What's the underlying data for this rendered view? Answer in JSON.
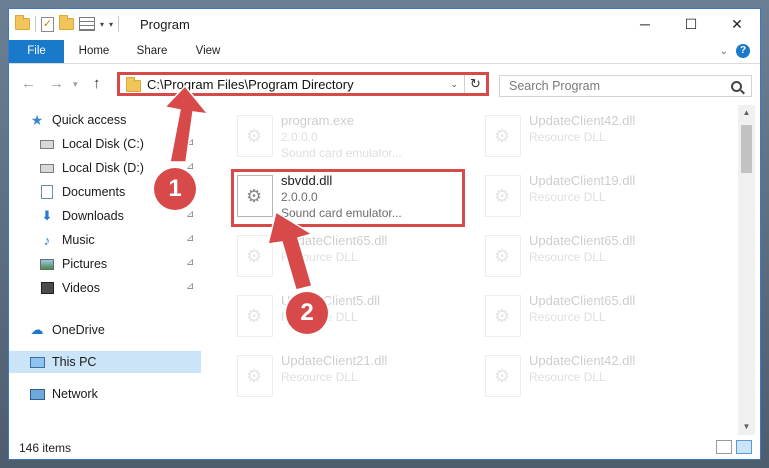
{
  "window": {
    "title": "Program",
    "minimize_glyph": "─",
    "maximize_glyph": "☐",
    "close_glyph": "✕"
  },
  "ribbon": {
    "tabs": [
      "File",
      "Home",
      "Share",
      "View"
    ]
  },
  "address": {
    "path": "C:\\Program Files\\Program Directory",
    "search_placeholder": "Search Program"
  },
  "sidebar": {
    "items": [
      {
        "label": "Quick access",
        "icon": "star-icon",
        "pinned": false
      },
      {
        "label": "Local Disk (C:)",
        "icon": "drive-icon",
        "pinned": true
      },
      {
        "label": "Local Disk (D:)",
        "icon": "drive-icon",
        "pinned": true
      },
      {
        "label": "Documents",
        "icon": "documents-icon",
        "pinned": true
      },
      {
        "label": "Downloads",
        "icon": "downloads-icon",
        "pinned": true
      },
      {
        "label": "Music",
        "icon": "music-icon",
        "pinned": true
      },
      {
        "label": "Pictures",
        "icon": "pictures-icon",
        "pinned": true
      },
      {
        "label": "Videos",
        "icon": "videos-icon",
        "pinned": true
      },
      {
        "label": "OneDrive",
        "icon": "onedrive-icon",
        "pinned": false
      },
      {
        "label": "This PC",
        "icon": "this-pc-icon",
        "pinned": false,
        "selected": true
      },
      {
        "label": "Network",
        "icon": "network-icon",
        "pinned": false
      }
    ]
  },
  "files": [
    {
      "name": "program.exe",
      "line1": "2.0.0.0",
      "line2": "Sound card emulator...",
      "faded": true
    },
    {
      "name": "UpdateClient42.dll",
      "line1": "Resource DLL",
      "line2": "",
      "faded": true
    },
    {
      "name": "sbvdd.dll",
      "line1": "2.0.0.0",
      "line2": "Sound card emulator...",
      "faded": false,
      "highlighted": true
    },
    {
      "name": "UpdateClient19.dll",
      "line1": "Resource DLL",
      "line2": "",
      "faded": true
    },
    {
      "name": "UpdateClient65.dll",
      "line1": "Resource DLL",
      "line2": "",
      "faded": true
    },
    {
      "name": "UpdateClient65.dll",
      "line1": "Resource DLL",
      "line2": "",
      "faded": true
    },
    {
      "name": "UpdateClient5.dll",
      "line1": "Resource DLL",
      "line2": "",
      "faded": true
    },
    {
      "name": "UpdateClient65.dll",
      "line1": "Resource DLL",
      "line2": "",
      "faded": true
    },
    {
      "name": "UpdateClient21.dll",
      "line1": "Resource DLL",
      "line2": "",
      "faded": true
    },
    {
      "name": "UpdateClient42.dll",
      "line1": "Resource DLL",
      "line2": "",
      "faded": true
    }
  ],
  "status": {
    "item_count": "146 items"
  },
  "annotations": {
    "badge_1": "1",
    "badge_2": "2",
    "color": "#d84a4a"
  }
}
